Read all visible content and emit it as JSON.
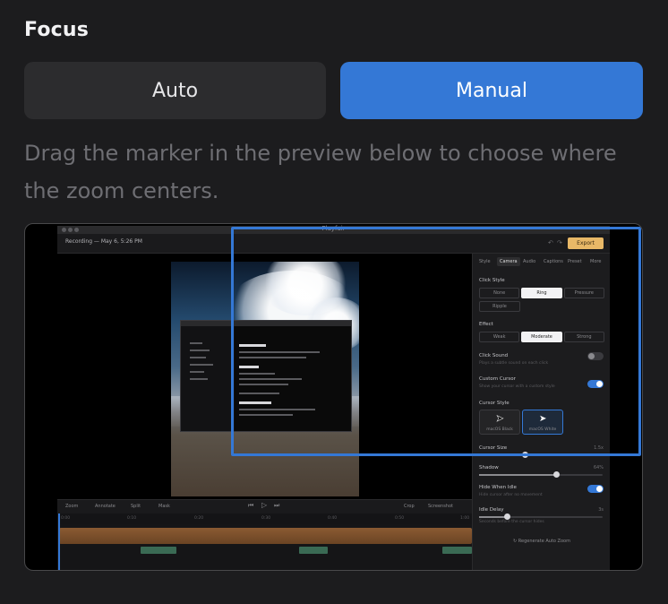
{
  "section": {
    "title": "Focus"
  },
  "focus_mode": {
    "options": [
      {
        "label": "Auto"
      },
      {
        "label": "Manual"
      }
    ],
    "selected": "Manual"
  },
  "description": "Drag the marker in the preview below to choose where the zoom centers.",
  "preview": {
    "window_title": "Playfair",
    "recording_label": "Recording — May 6, 5:26 PM",
    "export_label": "Export",
    "panel": {
      "tabs": [
        "Style",
        "Camera",
        "Audio",
        "Captions",
        "Preset",
        "More"
      ],
      "active_tab": "Camera",
      "click_style": {
        "label": "Click Style",
        "options": [
          "None",
          "Ring",
          "Pressure",
          "Ripple"
        ],
        "selected": "Ring"
      },
      "effect": {
        "label": "Effect",
        "options": [
          "Weak",
          "Moderate",
          "Strong"
        ],
        "selected": "Moderate"
      },
      "click_sound": {
        "label": "Click Sound",
        "sub": "Plays a subtle sound on each click",
        "on": false
      },
      "custom_cursor": {
        "label": "Custom Cursor",
        "sub": "Show your cursor with a custom style",
        "on": true
      },
      "cursor_style": {
        "label": "Cursor Style",
        "options": [
          "macOS Black",
          "macOS White"
        ],
        "selected": "macOS White"
      },
      "cursor_size": {
        "label": "Cursor Size",
        "value": "1.5x"
      },
      "shadow": {
        "label": "Shadow",
        "value": "64%"
      },
      "hide_when_idle": {
        "label": "Hide When Idle",
        "sub": "Hide cursor after no movement",
        "on": true
      },
      "idle_delay": {
        "label": "Idle Delay",
        "value": "3s",
        "sub": "Seconds before the cursor hides"
      },
      "regenerate_label": "Regenerate Auto Zoom"
    },
    "controls": [
      "Zoom",
      "Annotate",
      "Split",
      "Mask",
      "Crop",
      "Screenshot"
    ],
    "ruler": [
      "0:00",
      "0:10",
      "0:20",
      "0:30",
      "0:40",
      "0:50",
      "1:00"
    ]
  },
  "colors": {
    "accent": "#3478d6",
    "background": "#1c1c1e",
    "segment": "#2c2c2e",
    "muted_text": "#6e6e73"
  }
}
